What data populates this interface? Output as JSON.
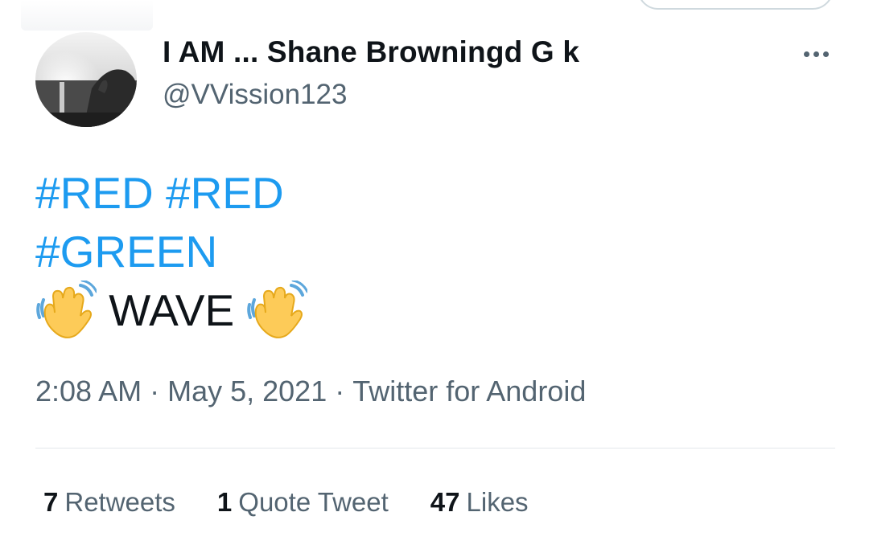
{
  "tweet": {
    "author": {
      "display_name": "I AM ... Shane Browningd G k",
      "handle": "@VVission123"
    },
    "lines": [
      {
        "hashtags": [
          "#RED",
          "#RED"
        ]
      },
      {
        "hashtags": [
          "#GREEN"
        ]
      },
      {
        "text": "WAVE",
        "emoji": "waving-hand-icon"
      }
    ],
    "time": "2:08 AM",
    "date": "May 5, 2021",
    "source": "Twitter for Android",
    "separator": "·",
    "stats": {
      "retweets": {
        "count": "7",
        "label": "Retweets"
      },
      "quote_tweets": {
        "count": "1",
        "label": "Quote Tweet"
      },
      "likes": {
        "count": "47",
        "label": "Likes"
      }
    }
  },
  "icons": {
    "more": "more-dots-icon",
    "emoji": "waving-hand-icon"
  },
  "colors": {
    "hashtag": "#1d9bf0",
    "primary_text": "#0f1419",
    "secondary_text": "#536471",
    "divider": "#e4e8eb"
  }
}
